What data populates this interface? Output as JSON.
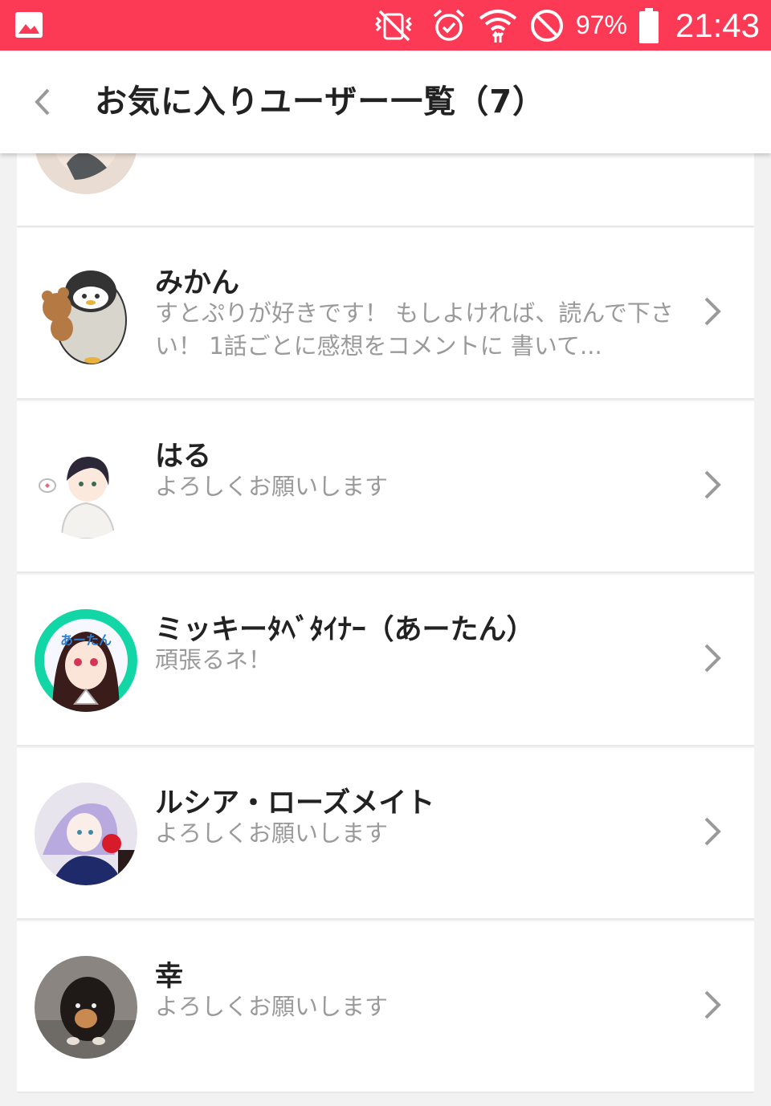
{
  "status_bar": {
    "battery": "97%",
    "time": "21:43",
    "background": "#fc3a56"
  },
  "header": {
    "title": "お気に入りユーザー一覧（7）"
  },
  "users": [
    {
      "name": "みかん",
      "desc": "すとぷりが好きです！ もしよければ、読んで下さい！ 1話ごとに感想をコメントに 書いて..."
    },
    {
      "name": "はる",
      "desc": "よろしくお願いします"
    },
    {
      "name": "ミッキーﾀﾍﾞﾀｲﾅｰ（あーたん）",
      "desc": "頑張るネ！"
    },
    {
      "name": "ルシア・ローズメイト",
      "desc": "よろしくお願いします"
    },
    {
      "name": "幸",
      "desc": "よろしくお願いします"
    }
  ]
}
